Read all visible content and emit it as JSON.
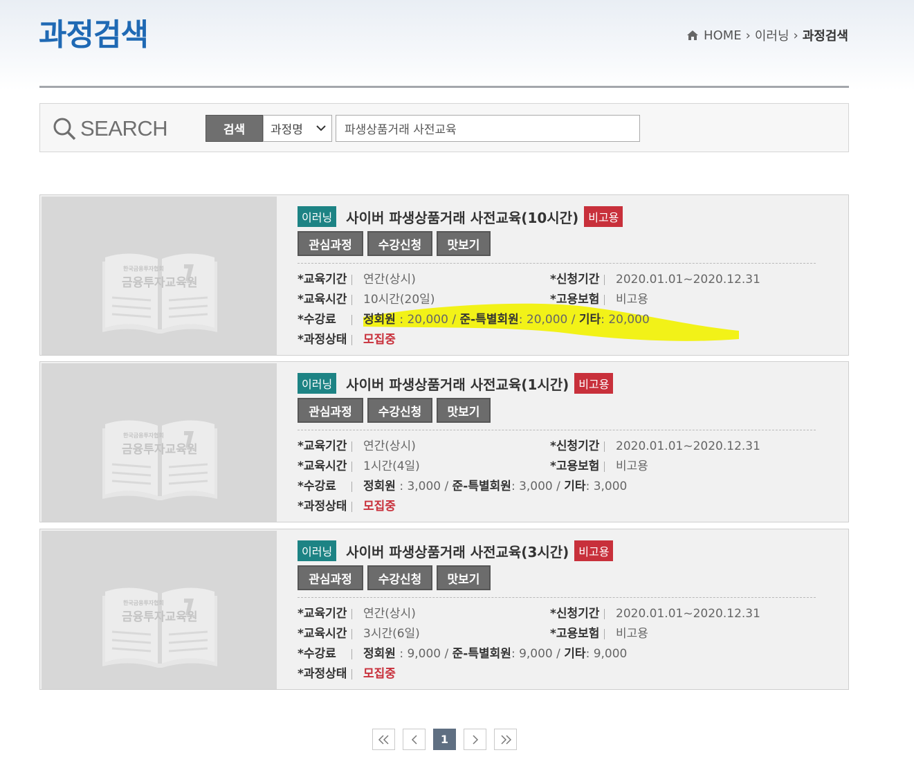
{
  "page": {
    "title": "과정검색"
  },
  "breadcrumb": {
    "home": "HOME",
    "level1": "이러닝",
    "current": "과정검색"
  },
  "search": {
    "logo_text": "SEARCH",
    "button_label": "검색",
    "select_value": "과정명",
    "query": "파생상품거래 사전교육"
  },
  "labels": {
    "period": "*교육기간",
    "hours": "*교육시간",
    "fee": "*수강료",
    "status": "*과정상태",
    "apply": "*신청기간",
    "insurance": "*고용보험",
    "btn_interest": "관심과정",
    "btn_apply": "수강신청",
    "btn_preview": "맛보기",
    "fee_regular": "정회원",
    "fee_associate": "준-특별회원",
    "fee_other": "기타"
  },
  "courses": [
    {
      "type": "이러닝",
      "name": "사이버 파생상품거래 사전교육(10시간)",
      "insurance_badge": "비고용",
      "period": "연간(상시)",
      "hours": "10시간(20일)",
      "fee_regular": " : 20,000 / ",
      "fee_associate": ": 20,000 / ",
      "fee_other": ": 20,000",
      "status": "모집중",
      "apply_period": "2020.01.01~2020.12.31",
      "insurance": "비고용"
    },
    {
      "type": "이러닝",
      "name": "사이버 파생상품거래 사전교육(1시간)",
      "insurance_badge": "비고용",
      "period": "연간(상시)",
      "hours": "1시간(4일)",
      "fee_regular": " : 3,000 / ",
      "fee_associate": ": 3,000 / ",
      "fee_other": ": 3,000",
      "status": "모집중",
      "apply_period": "2020.01.01~2020.12.31",
      "insurance": "비고용"
    },
    {
      "type": "이러닝",
      "name": "사이버 파생상품거래 사전교육(3시간)",
      "insurance_badge": "비고용",
      "period": "연간(상시)",
      "hours": "3시간(6일)",
      "fee_regular": " : 9,000 / ",
      "fee_associate": ": 9,000 / ",
      "fee_other": ": 9,000",
      "status": "모집중",
      "apply_period": "2020.01.01~2020.12.31",
      "insurance": "비고용"
    }
  ],
  "thumbnail": {
    "org_small": "한국금융투자협회",
    "org_name": "금융투자교육원"
  },
  "pagination": {
    "first": "«",
    "prev": "‹",
    "current": "1",
    "next": "›",
    "last": "»"
  },
  "colors": {
    "title_blue": "#1f69b4",
    "teal_badge": "#1d8384",
    "red_badge": "#c8303b",
    "highlight": "#f2f200"
  }
}
